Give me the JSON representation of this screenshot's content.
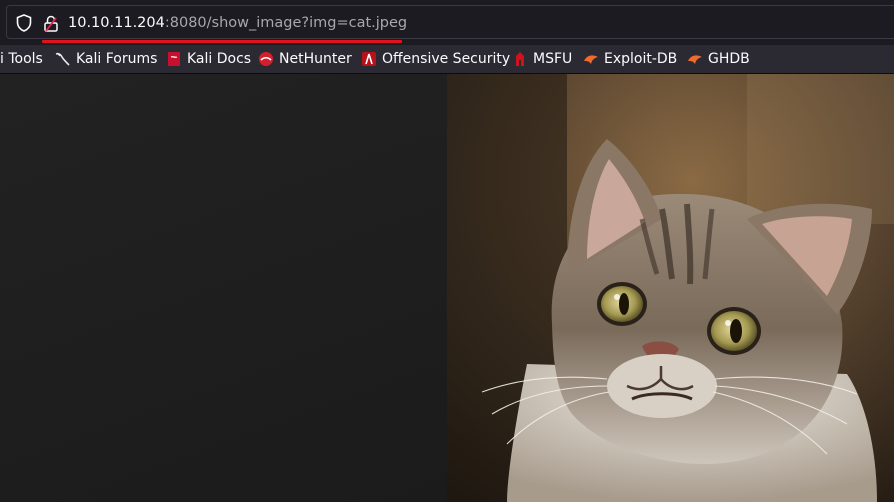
{
  "urlbar": {
    "host": "10.10.11.204",
    "rest": ":8080/show_image?img=cat.jpeg"
  },
  "bookmarks": [
    {
      "label": "i Tools",
      "icon": "kali-tools-icon"
    },
    {
      "label": "Kali Forums",
      "icon": "kali-dragon-icon"
    },
    {
      "label": "Kali Docs",
      "icon": "kali-docs-icon"
    },
    {
      "label": "NetHunter",
      "icon": "nethunter-icon"
    },
    {
      "label": "Offensive Security",
      "icon": "offsec-icon"
    },
    {
      "label": "MSFU",
      "icon": "msfu-icon"
    },
    {
      "label": "Exploit-DB",
      "icon": "exploit-db-icon"
    },
    {
      "label": "GHDB",
      "icon": "ghdb-icon"
    }
  ],
  "colors": {
    "accent_underline": "#e0121b",
    "background": "#1c1b22",
    "bookmarks_bar": "#2b2a33"
  }
}
